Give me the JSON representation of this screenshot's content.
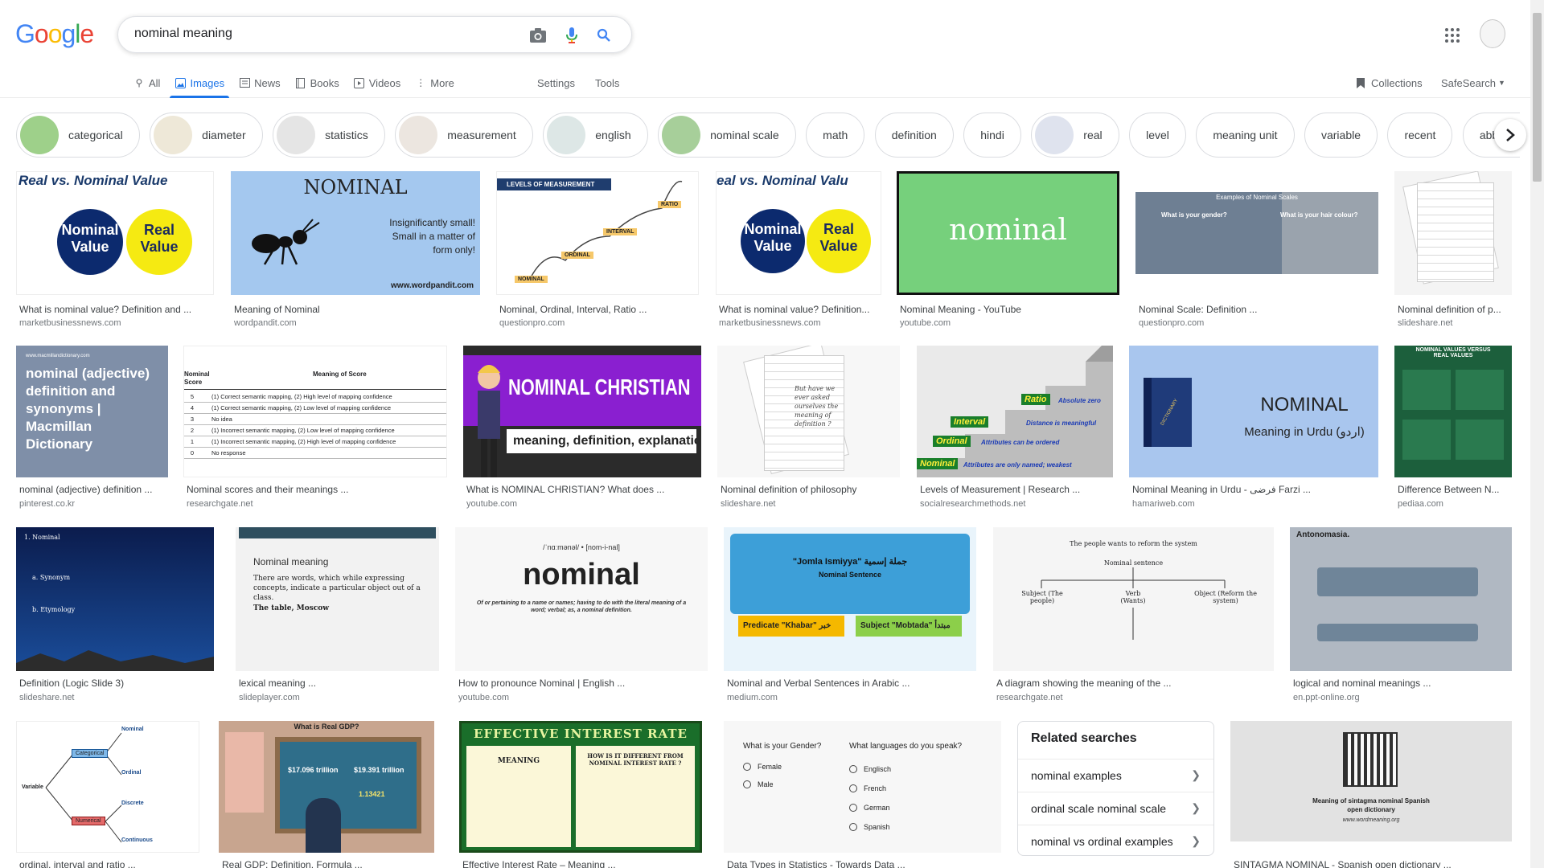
{
  "logo": "Google",
  "search": {
    "query": "nominal meaning"
  },
  "tabs": [
    {
      "label": "All",
      "icon": "search-icon"
    },
    {
      "label": "Images",
      "icon": "image-icon",
      "active": true
    },
    {
      "label": "News",
      "icon": "news-icon"
    },
    {
      "label": "Books",
      "icon": "book-icon"
    },
    {
      "label": "Videos",
      "icon": "video-icon"
    },
    {
      "label": "More",
      "icon": "more-vert-icon"
    }
  ],
  "settings": "Settings",
  "tools": "Tools",
  "collections": "Collections",
  "safesearch": "SafeSearch",
  "chips": [
    "categorical",
    "diameter",
    "statistics",
    "measurement",
    "english",
    "nominal scale",
    "math",
    "definition",
    "hindi",
    "real",
    "level",
    "meaning unit",
    "variable",
    "recent",
    "abbreviation"
  ],
  "images": {
    "i1": {
      "title": "What is nominal value? Definition and ...",
      "source": "marketbusinessnews.com",
      "heading": "Real vs. Nominal Value",
      "a": "Nominal Value",
      "b": "Real Value"
    },
    "i2": {
      "title": "Meaning of Nominal",
      "source": "wordpandit.com",
      "heading": "NOMINAL",
      "sub": "Insignificantly small! Small in a matter of form only!",
      "foot": "www.wordpandit.com"
    },
    "i3": {
      "title": "Nominal, Ordinal, Interval, Ratio ...",
      "source": "questionpro.com",
      "heading": "LEVELS OF MEASUREMENT",
      "l1": "NOMINAL",
      "l2": "ORDINAL",
      "l3": "INTERVAL",
      "l4": "RATIO"
    },
    "i4": {
      "title": "What is nominal value? Definition...",
      "source": "marketbusinessnews.com",
      "heading": "eal vs. Nominal Valu",
      "a": "Nominal Value",
      "b": "Real Value"
    },
    "i5": {
      "title": "Nominal Meaning - YouTube",
      "source": "youtube.com",
      "word": "nominal"
    },
    "i6": {
      "title": "Nominal Scale: Definition ...",
      "source": "questionpro.com",
      "heading": "Examples of Nominal Scales",
      "q1": "What is your gender?",
      "q2": "What is your hair colour?"
    },
    "i7": {
      "title": "Nominal definition of p...",
      "source": "slideshare.net"
    },
    "i8": {
      "title": "nominal (adjective) definition ...",
      "source": "pinterest.co.kr",
      "text": "nominal (adjective) definition and synonyms | Macmillan Dictionary",
      "top": "www.macmillandictionary.com"
    },
    "i9": {
      "title": "Nominal scores and their meanings ...",
      "source": "researchgate.net",
      "h1": "Nominal Score",
      "h2": "Meaning of Score",
      "rows": [
        [
          "5",
          "(1) Correct semantic mapping, (2) High level of mapping confidence"
        ],
        [
          "4",
          "(1) Correct semantic mapping, (2) Low level of mapping confidence"
        ],
        [
          "3",
          "No idea"
        ],
        [
          "2",
          "(1) Incorrect semantic mapping, (2) Low level of mapping confidence"
        ],
        [
          "1",
          "(1) Incorrect semantic mapping, (2) High level of mapping confidence"
        ],
        [
          "0",
          "No response"
        ]
      ]
    },
    "i10": {
      "title": "What is NOMINAL CHRISTIAN? What does ...",
      "source": "youtube.com",
      "heading": "NOMINAL CHRISTIAN",
      "sub": "meaning, definition, explanation..."
    },
    "i11": {
      "title": "Nominal definition of philosophy",
      "source": "slideshare.net",
      "note": "But have we ever asked ourselves the meaning of definition ?"
    },
    "i12": {
      "title": "Levels of Measurement | Research ...",
      "source": "socialresearchmethods.net",
      "s1": "Ratio",
      "s2": "Interval",
      "s3": "Ordinal",
      "s4": "Nominal",
      "d1": "Absolute zero",
      "d2": "Distance is meaningful",
      "d3": "Attributes can be ordered",
      "d4": "Attributes are only named; weakest"
    },
    "i13": {
      "title": "Nominal Meaning in Urdu - فرضی Farzi ...",
      "source": "hamariweb.com",
      "heading": "NOMINAL",
      "sub": "Meaning in Urdu (اردو)",
      "book": "DICTIONARY"
    },
    "i14": {
      "title": "Difference Between N...",
      "source": "pediaa.com",
      "heading": "NOMINAL VALUES VERSUS REAL VALUES"
    },
    "i15": {
      "title": "Definition (Logic Slide 3)",
      "source": "slideshare.net",
      "t1": "1. Nominal",
      "t2": "a. Synonym",
      "t3": "b. Etymology"
    },
    "i16": {
      "title": "lexical meaning ...",
      "source": "slideplayer.com",
      "heading": "Nominal meaning",
      "body": "There are words, which while expressing concepts, indicate a particular object out of a class.",
      "ex": "The table, Moscow"
    },
    "i17": {
      "title": "How to pronounce Nominal | English ...",
      "source": "youtube.com",
      "phon": "/ˈnɑːmənəl/ • [nom-i-nal]",
      "word": "nominal",
      "def": "Of or pertaining to a name or names; having to do with the literal meaning of a word; verbal; as, a nominal definition."
    },
    "i18": {
      "title": "Nominal and Verbal Sentences in Arabic ...",
      "source": "medium.com",
      "heading": "\"Jomla Ismiyya\" جملة إسمية",
      "sub": "Nominal Sentence",
      "p1": "Predicate \"Khabar\" خبر",
      "p2": "Subject \"Mobtada\" مبتدأ"
    },
    "i19": {
      "title": "A diagram showing the meaning of the ...",
      "source": "researchgate.net",
      "top": "The people wants to reform the system",
      "mid": "Nominal sentence",
      "a": "Subject (The people)",
      "b": "Verb (Wants)",
      "c": "Object (Reform the system)"
    },
    "i20": {
      "title": "logical and nominal meanings ...",
      "source": "en.ppt-online.org",
      "heading": "Antonomasia."
    },
    "i21": {
      "title": "ordinal, interval and ratio ...",
      "source": "",
      "n1": "Nominal",
      "n2": "Categorical",
      "n3": "Ordinal",
      "n4": "Variable",
      "n5": "Discrete",
      "n6": "Continuous"
    },
    "i22": {
      "title": "Real GDP: Definition, Formula ...",
      "source": "",
      "heading": "What is Real GDP?",
      "v1": "$17.096 trillion",
      "v2": "$19.391 trillion",
      "v3": "1.13421"
    },
    "i23": {
      "title": "Effective Interest Rate – Meaning ...",
      "source": "",
      "heading": "EFFECTIVE INTEREST RATE",
      "m": "MEANING",
      "h": "HOW IS IT DIFFERENT FROM NOMINAL INTEREST RATE ?"
    },
    "i24": {
      "title": "Data Types in Statistics - Towards Data ...",
      "source": "",
      "q1": "What is your Gender?",
      "q2": "What languages do you speak?",
      "g": [
        "Female",
        "Male"
      ],
      "l": [
        "Englisch",
        "French",
        "German",
        "Spanish"
      ]
    },
    "i25": {
      "title": "SINTAGMA NOMINAL - Spanish open dictionary ...",
      "source": "",
      "text": "Meaning of sintagma nominal Spanish open dictionary",
      "url": "www.wordmeaning.org"
    }
  },
  "related": {
    "title": "Related searches",
    "items": [
      "nominal examples",
      "ordinal scale nominal scale",
      "nominal vs ordinal examples"
    ]
  }
}
